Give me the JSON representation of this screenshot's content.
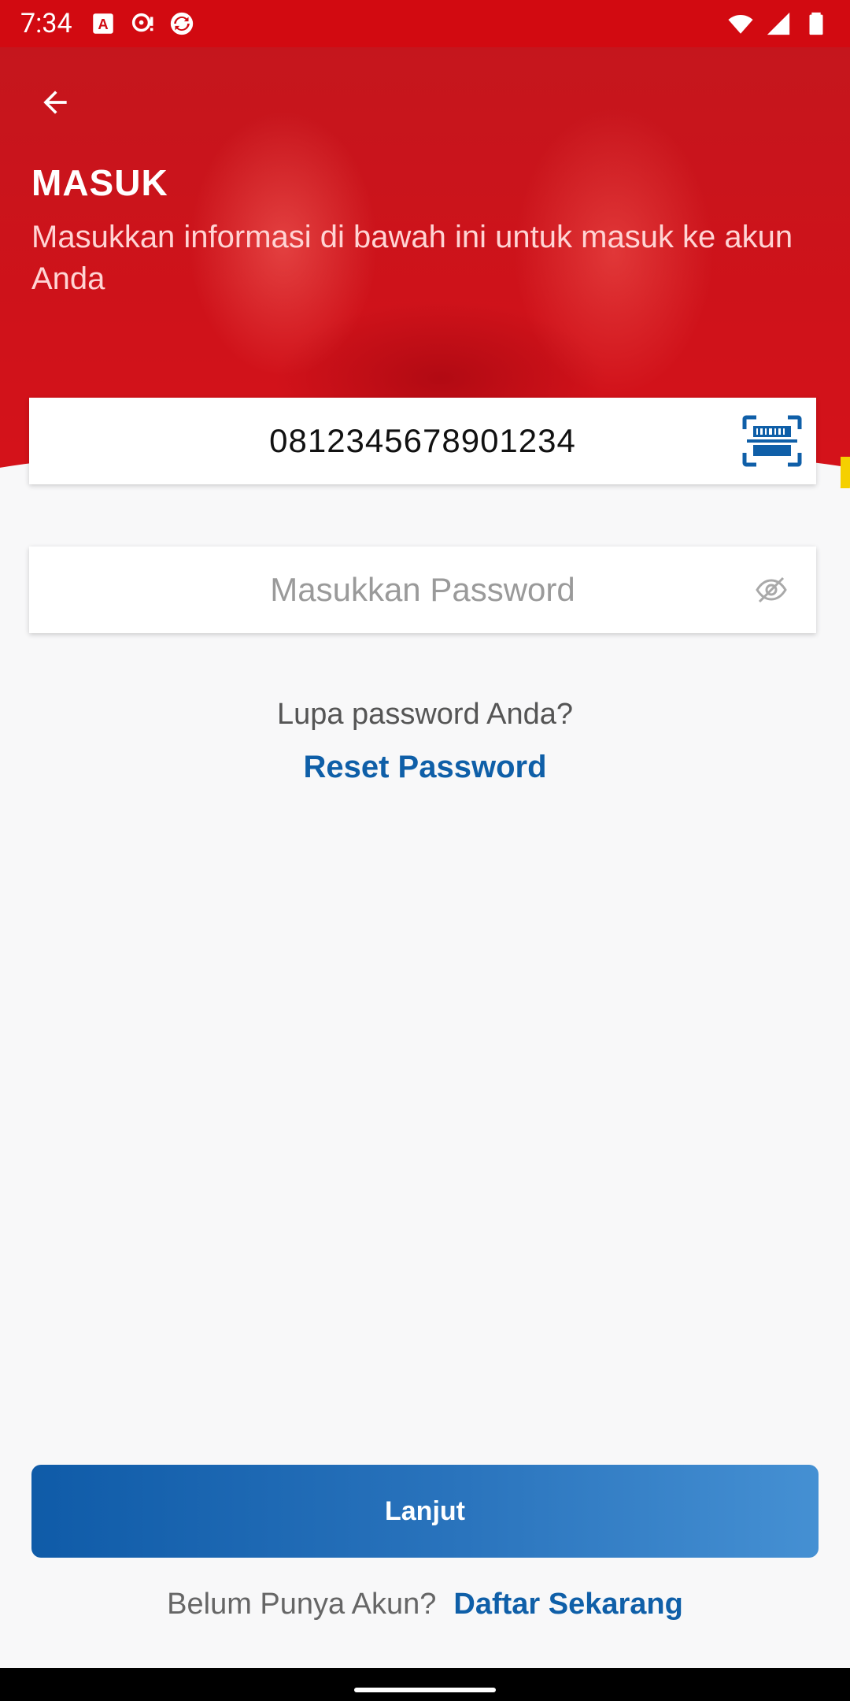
{
  "status_bar": {
    "time": "7:34",
    "left_icons": [
      "text-a-icon",
      "notification-bubble-icon",
      "sync-app-icon"
    ],
    "right_icons": [
      "wifi-icon",
      "signal-icon",
      "battery-icon"
    ]
  },
  "header": {
    "back_icon": "arrow-left-icon",
    "title": "MASUK",
    "subtitle": "Masukkan informasi di bawah ini untuk masuk ke akun Anda"
  },
  "form": {
    "phone": {
      "value": "0812345678901234",
      "scan_icon": "barcode-scan-icon"
    },
    "password": {
      "placeholder": "Masukkan Password",
      "visibility_icon": "eye-off-icon"
    },
    "forgot_text": "Lupa password Anda?",
    "reset_link": "Reset Password",
    "submit_label": "Lanjut"
  },
  "signup": {
    "question": "Belum Punya Akun?",
    "link": "Daftar Sekarang"
  },
  "colors": {
    "brand_red": "#d20a11",
    "link_blue": "#0f5fa8",
    "accent_yellow": "#f5d000"
  }
}
